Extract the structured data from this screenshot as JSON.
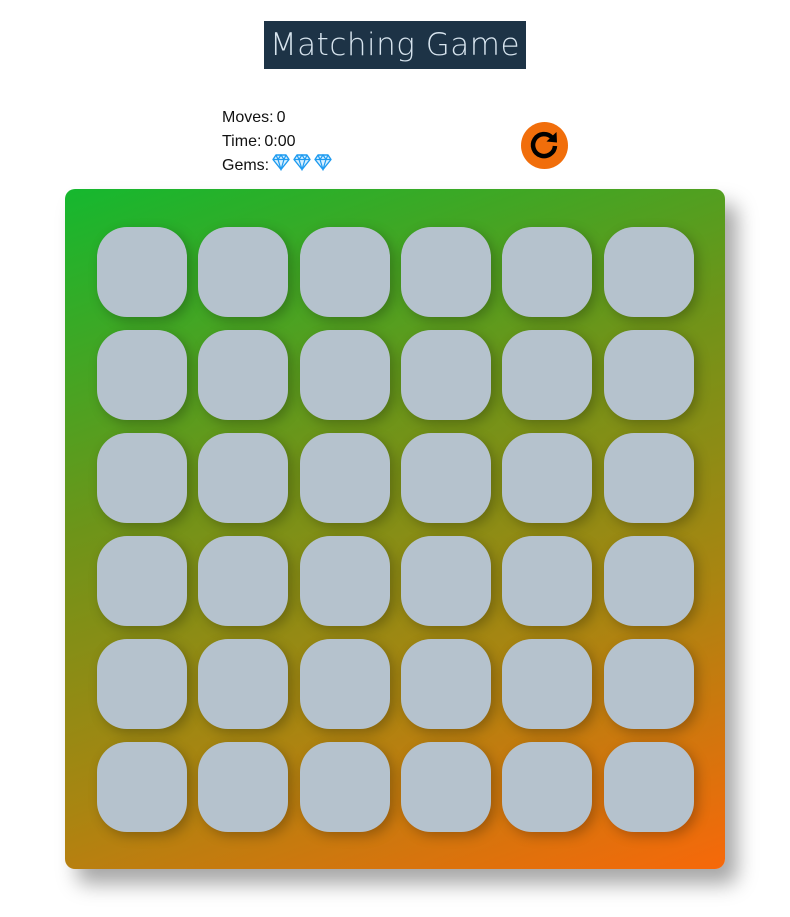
{
  "title": "Matching Game",
  "stats": {
    "moves_label": "Moves:",
    "moves_value": "0",
    "time_label": "Time:",
    "time_value": "0:00",
    "gems_label": "Gems:",
    "gems_count": 3,
    "gem_icon": "diamond-icon",
    "gem_color": "#1e9bf0"
  },
  "restart": {
    "icon": "restart-icon",
    "color": "#f16e0b"
  },
  "board": {
    "rows": 6,
    "cols": 6,
    "card_state": "face-down",
    "card_color": "#b5c2cd",
    "gradient_colors": [
      "#15b82f",
      "#f7680a"
    ]
  }
}
